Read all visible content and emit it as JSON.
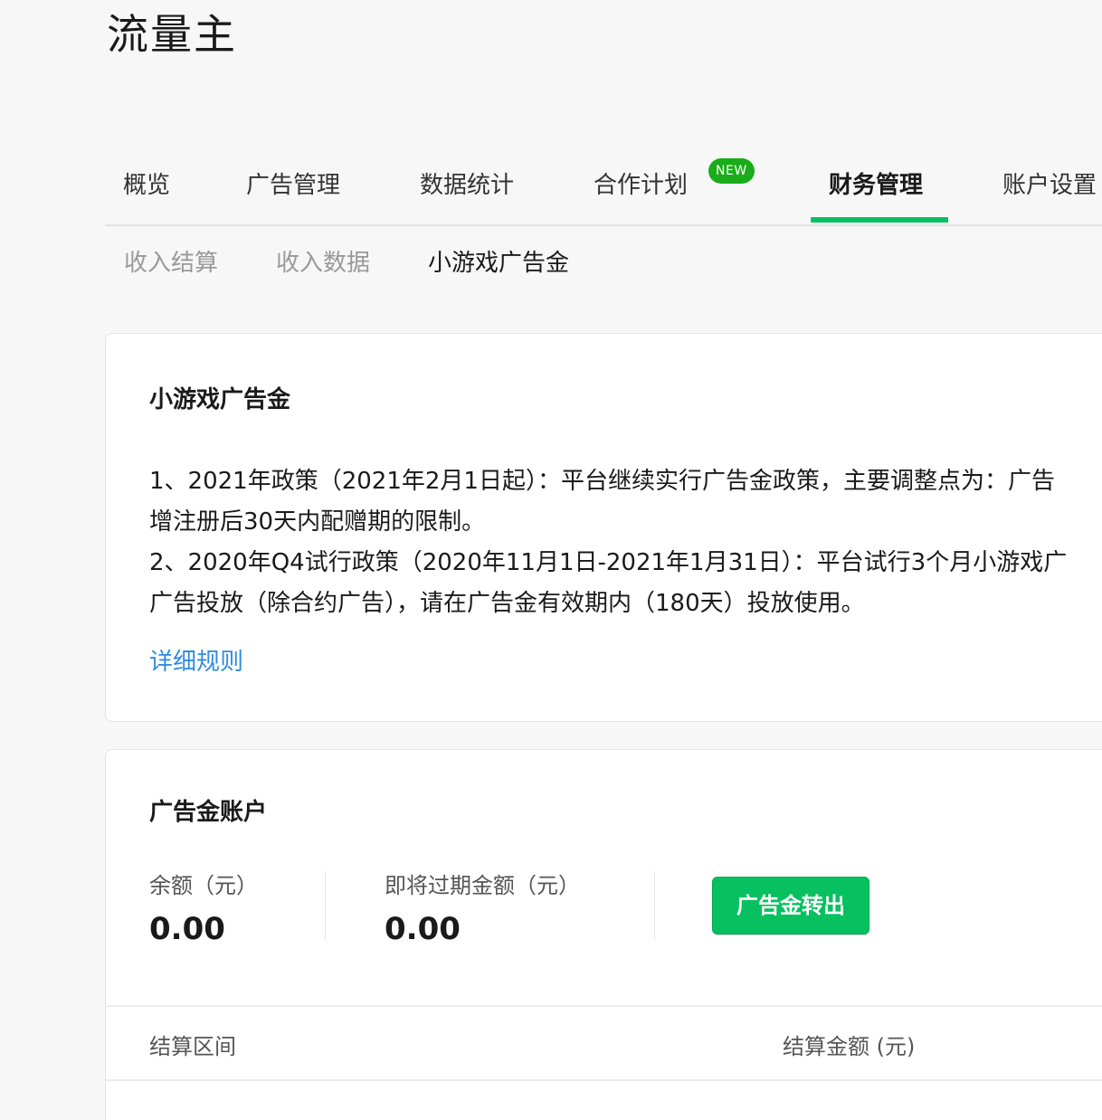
{
  "app": {
    "title": "流量主"
  },
  "main_tabs": [
    {
      "label": "概览"
    },
    {
      "label": "广告管理"
    },
    {
      "label": "数据统计"
    },
    {
      "label": "合作计划",
      "badge": "NEW"
    },
    {
      "label": "财务管理",
      "active": true
    },
    {
      "label": "账户设置"
    }
  ],
  "sub_tabs": [
    {
      "label": "收入结算"
    },
    {
      "label": "收入数据"
    },
    {
      "label": "小游戏广告金",
      "active": true
    }
  ],
  "ad_fund_info": {
    "title": "小游戏广告金",
    "policy_lines": [
      "1、2021年政策（2021年2月1日起）：平台继续实行广告金政策，主要调整点为：广告",
      "增注册后30天内配赠期的限制。",
      "2、2020年Q4试行政策（2020年11月1日-2021年1月31日）：平台试行3个月小游戏广",
      "广告投放（除合约广告），请在广告金有效期内（180天）投放使用。"
    ],
    "rules_link": "详细规则"
  },
  "ad_fund_account": {
    "title": "广告金账户",
    "balance_label": "余额（元）",
    "balance_value": "0.00",
    "expiring_label": "即将过期金额（元）",
    "expiring_value": "0.00",
    "transfer_button": "广告金转出",
    "table_headers": [
      "结算区间",
      "结算金额 (元)"
    ]
  },
  "colors": {
    "accent": "#07c160",
    "badge": "#1aad19",
    "link": "#2f8be0"
  }
}
